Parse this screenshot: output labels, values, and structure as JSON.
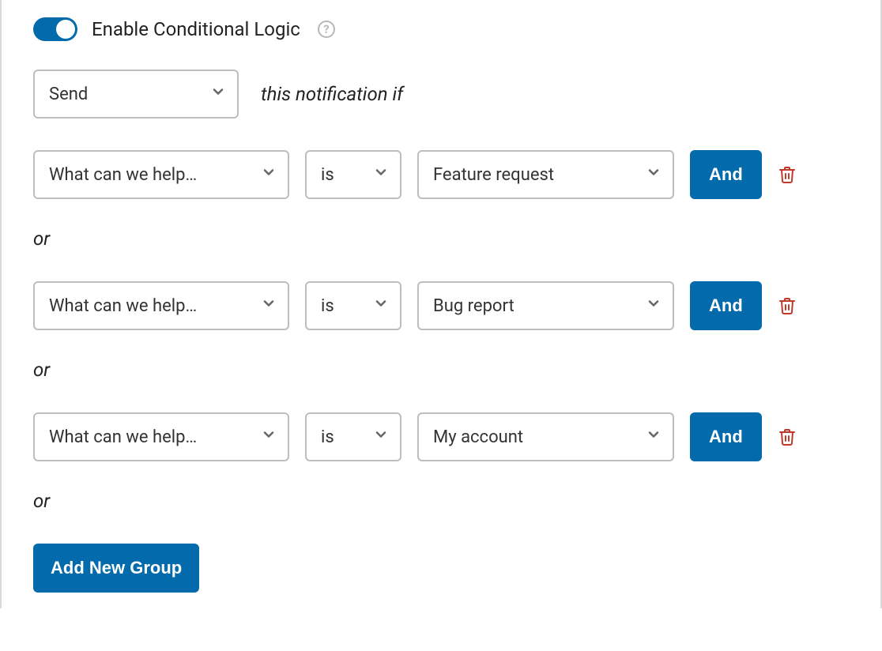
{
  "header": {
    "toggle_on": true,
    "label": "Enable Conditional Logic",
    "help_glyph": "?"
  },
  "action": {
    "select_value": "Send",
    "trailing_text": "this notification if"
  },
  "separator_text": "or",
  "and_button_label": "And",
  "add_group_label": "Add New Group",
  "rules": [
    {
      "field": "What can we help…",
      "operator": "is",
      "value": "Feature request"
    },
    {
      "field": "What can we help…",
      "operator": "is",
      "value": "Bug report"
    },
    {
      "field": "What can we help…",
      "operator": "is",
      "value": "My account"
    }
  ]
}
